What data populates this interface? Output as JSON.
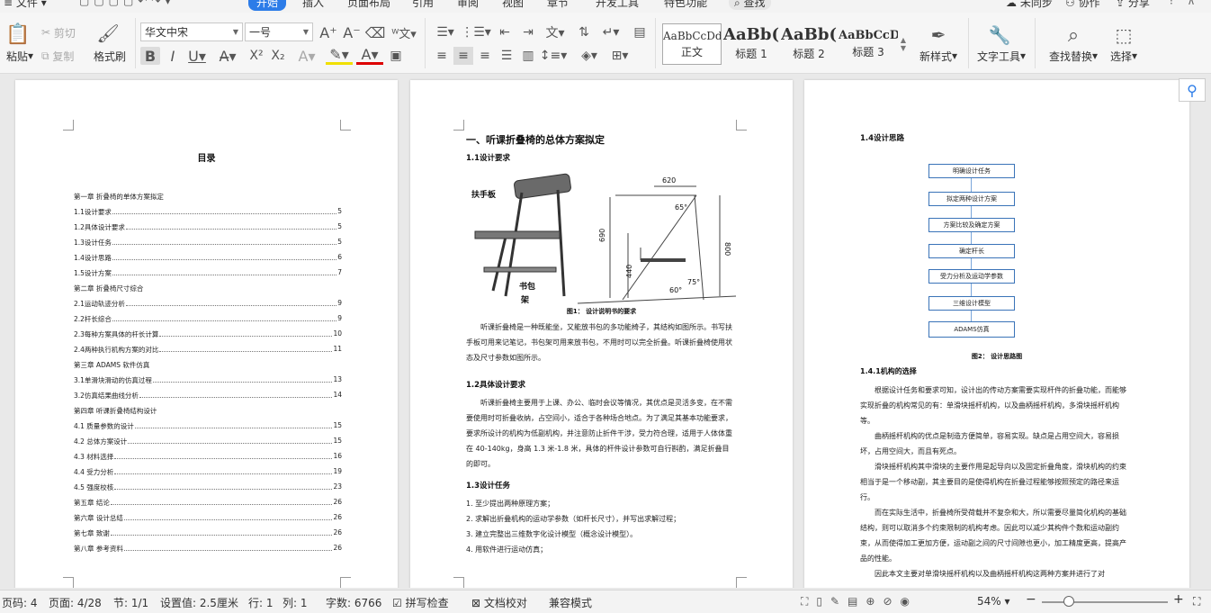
{
  "menu": {
    "file": "文件",
    "tabs": [
      "开始",
      "插入",
      "页面布局",
      "引用",
      "审阅",
      "视图",
      "章节",
      "开发工具",
      "特色功能"
    ],
    "search": "查找",
    "sync": "未同步",
    "collab": "协作",
    "share": "分享"
  },
  "ribbon": {
    "paste": "粘贴",
    "cut": "剪切",
    "copy": "复制",
    "format_painter": "格式刷",
    "font_name": "华文中宋",
    "font_size": "一号",
    "styles": [
      {
        "preview": "AaBbCcDd",
        "label": "正文"
      },
      {
        "preview": "AaBb(",
        "label": "标题 1"
      },
      {
        "preview": "AaBb(",
        "label": "标题 2"
      },
      {
        "preview": "AaBbCcD",
        "label": "标题 3"
      }
    ],
    "new_style": "新样式",
    "text_tools": "文字工具",
    "find_replace": "查找替换",
    "select": "选择"
  },
  "page1": {
    "title": "目录",
    "toc": [
      {
        "t": "第一章 折叠椅的单体方案拟定",
        "p": ""
      },
      {
        "t": "1.1设计要求",
        "p": "5"
      },
      {
        "t": "1.2具体设计要求",
        "p": "5"
      },
      {
        "t": "1.3设计任务",
        "p": "5"
      },
      {
        "t": "1.4设计思路",
        "p": "6"
      },
      {
        "t": "1.5设计方案",
        "p": "7"
      },
      {
        "t": "第二章 折叠椅尺寸综合",
        "p": ""
      },
      {
        "t": "2.1运动轨迹分析",
        "p": "9"
      },
      {
        "t": "2.2杆长综合",
        "p": "9"
      },
      {
        "t": "2.3每种方案具体的杆长计算",
        "p": "10"
      },
      {
        "t": "2.4两种执行机构方案的对比",
        "p": "11"
      },
      {
        "t": "第三章 ADAMS 软件仿真",
        "p": ""
      },
      {
        "t": "3.1单滑块滑动的仿真过程",
        "p": "13"
      },
      {
        "t": "3.2仿真结果曲线分析",
        "p": "14"
      },
      {
        "t": "第四章 听课折叠椅结构设计",
        "p": ""
      },
      {
        "t": "4.1 质量参数的设计",
        "p": "15"
      },
      {
        "t": "4.2 总体方案设计",
        "p": "15"
      },
      {
        "t": "4.3 材料选择",
        "p": "16"
      },
      {
        "t": "4.4 受力分析",
        "p": "19"
      },
      {
        "t": "4.5 强度校核",
        "p": "23"
      },
      {
        "t": "第五章 结论",
        "p": "26"
      },
      {
        "t": "第六章 设计总结",
        "p": "26"
      },
      {
        "t": "第七章 致谢",
        "p": "26"
      },
      {
        "t": "第八章 参考资料",
        "p": "26"
      }
    ]
  },
  "page2": {
    "h1": "一、听课折叠椅的总体方案拟定",
    "h11": "1.1设计要求",
    "fig_labels": {
      "armrest": "扶手板",
      "bookbag_1": "书包",
      "bookbag_2": "架"
    },
    "dims": {
      "d620": "620",
      "d65": "65°",
      "d690": "690",
      "d440": "440",
      "d800": "800",
      "d60": "60°",
      "d75": "75°"
    },
    "fig1": "图1： 设计说明书的要求",
    "p1": "听课折叠椅是一种既能坐，又能放书包的多功能椅子，其结构如图所示。书写扶手板可用来记笔记，书包架可用来放书包，不用时可以完全折叠。听课折叠椅使用状态及尺寸参数如图所示。",
    "h12": "1.2具体设计要求",
    "p2": "听课折叠椅主要用于上课、办公、临时会议等情况，其优点是灵活多变，在不需要使用时可折叠收纳，占空间小，适合于各种场合地点。为了满足其基本功能要求，要求所设计的机构为低副机构，并注意防止折件干涉，受力符合理，适用于人体体重在 40-140kg，身高 1.3 米-1.8 米，具体的杆件设计参数可自行斟酌，满足折叠目的即可。",
    "h13": "1.3设计任务",
    "tasks": [
      "1. 至少提出两种原理方案；",
      "2. 求解出折叠机构的运动学参数（如杆长尺寸），并写出求解过程；",
      "3. 建立完整出三维数字化设计模型（概念设计模型）。",
      "4. 用软件进行运动仿真；"
    ]
  },
  "page3": {
    "h14": "1.4设计思路",
    "flow": [
      "明确设计任务",
      "拟定两种设计方案",
      "方案比较及确定方案",
      "确定杆长",
      "受力分析及运动学参数",
      "三维设计模型",
      "ADAMS仿真"
    ],
    "fig2": "图2： 设计思路图",
    "h141": "1.4.1机构的选择",
    "paras": [
      "根据设计任务和要求可知，设计出的传动方案需要实现杆件的折叠功能，而能够实现折叠的机构常见的有：单滑块摇杆机构，以及曲柄摇杆机构，多滑块摇杆机构等。",
      "曲柄摇杆机构的优点是制造方便简单，容易实现。缺点是占用空间大，容易损坏，占用空间大，而且有死点。",
      "滑块摇杆机构其中滑块的主要作用是起导向以及固定折叠角度，滑块机构的约束相当于是一个移动副，其主要目的是使得机构在折叠过程能够按照预定的路径来运行。",
      "而在实际生活中，折叠椅所受荷载并不复杂和大，所以需要尽量简化机构的基础结构，则可以取消多个约束限制的机构考虑。因此可以减少其构件个数和运动副约束，从而使得加工更加方便，运动副之间的尺寸间隙也更小，加工精度更高，提高产品的性能。",
      "因此本文主要对单滑块摇杆机构以及曲柄摇杆机构这两种方案并进行了对"
    ]
  },
  "status": {
    "page_num": "页码: 4",
    "pages": "页面: 4/28",
    "section": "节: 1/1",
    "setting": "设置值: 2.5厘米",
    "row": "行: 1",
    "col": "列: 1",
    "words": "字数: 6766",
    "spell": "拼写检查",
    "proof": "文档校对",
    "compat": "兼容模式",
    "zoom": "54%"
  },
  "colors": {
    "accent": "#2c7ce8",
    "flow_border": "#3a73b8"
  }
}
